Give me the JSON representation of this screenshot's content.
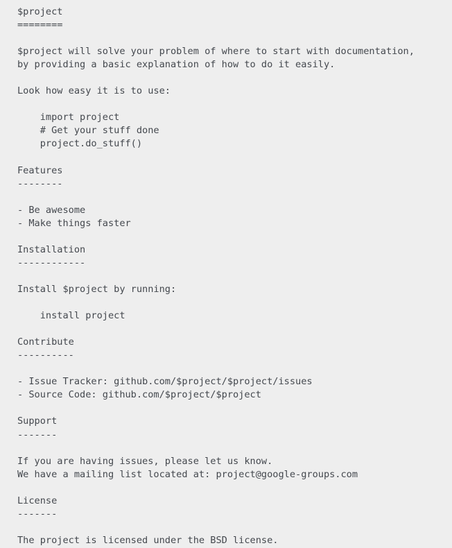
{
  "document": {
    "kind": "plain-text-readme",
    "format": "reStructuredText",
    "background_color": "#eeeeee",
    "text_color": "#44484e",
    "title": "$project",
    "title_underline": "========",
    "lines": [
      "$project",
      "========",
      "",
      "$project will solve your problem of where to start with documentation,",
      "by providing a basic explanation of how to do it easily.",
      "",
      "Look how easy it is to use:",
      "",
      "    import project",
      "    # Get your stuff done",
      "    project.do_stuff()",
      "",
      "Features",
      "--------",
      "",
      "- Be awesome",
      "- Make things faster",
      "",
      "Installation",
      "------------",
      "",
      "Install $project by running:",
      "",
      "    install project",
      "",
      "Contribute",
      "----------",
      "",
      "- Issue Tracker: github.com/$project/$project/issues",
      "- Source Code: github.com/$project/$project",
      "",
      "Support",
      "-------",
      "",
      "If you are having issues, please let us know.",
      "We have a mailing list located at: project@google-groups.com",
      "",
      "License",
      "-------",
      "",
      "The project is licensed under the BSD license."
    ],
    "sections": [
      {
        "heading": "$project",
        "underline": "========",
        "paragraphs": [
          "$project will solve your problem of where to start with documentation, by providing a basic explanation of how to do it easily.",
          "Look how easy it is to use:"
        ],
        "code_block": [
          "import project",
          "# Get your stuff done",
          "project.do_stuff()"
        ]
      },
      {
        "heading": "Features",
        "underline": "--------",
        "bullets": [
          "- Be awesome",
          "- Make things faster"
        ]
      },
      {
        "heading": "Installation",
        "underline": "------------",
        "paragraphs": [
          "Install $project by running:"
        ],
        "code_block": [
          "install project"
        ]
      },
      {
        "heading": "Contribute",
        "underline": "----------",
        "bullets": [
          "- Issue Tracker: github.com/$project/$project/issues",
          "- Source Code: github.com/$project/$project"
        ],
        "links": [
          "github.com/$project/$project/issues",
          "github.com/$project/$project"
        ]
      },
      {
        "heading": "Support",
        "underline": "-------",
        "paragraphs": [
          "If you are having issues, please let us know.",
          "We have a mailing list located at: project@google-groups.com"
        ],
        "email": "project@google-groups.com"
      },
      {
        "heading": "License",
        "underline": "-------",
        "paragraphs": [
          "The project is licensed under the BSD license."
        ]
      }
    ],
    "full_text": "$project\n========\n\n$project will solve your problem of where to start with documentation,\nby providing a basic explanation of how to do it easily.\n\nLook how easy it is to use:\n\n    import project\n    # Get your stuff done\n    project.do_stuff()\n\nFeatures\n--------\n\n- Be awesome\n- Make things faster\n\nInstallation\n------------\n\nInstall $project by running:\n\n    install project\n\nContribute\n----------\n\n- Issue Tracker: github.com/$project/$project/issues\n- Source Code: github.com/$project/$project\n\nSupport\n-------\n\nIf you are having issues, please let us know.\nWe have a mailing list located at: project@google-groups.com\n\nLicense\n-------\n\nThe project is licensed under the BSD license."
  }
}
